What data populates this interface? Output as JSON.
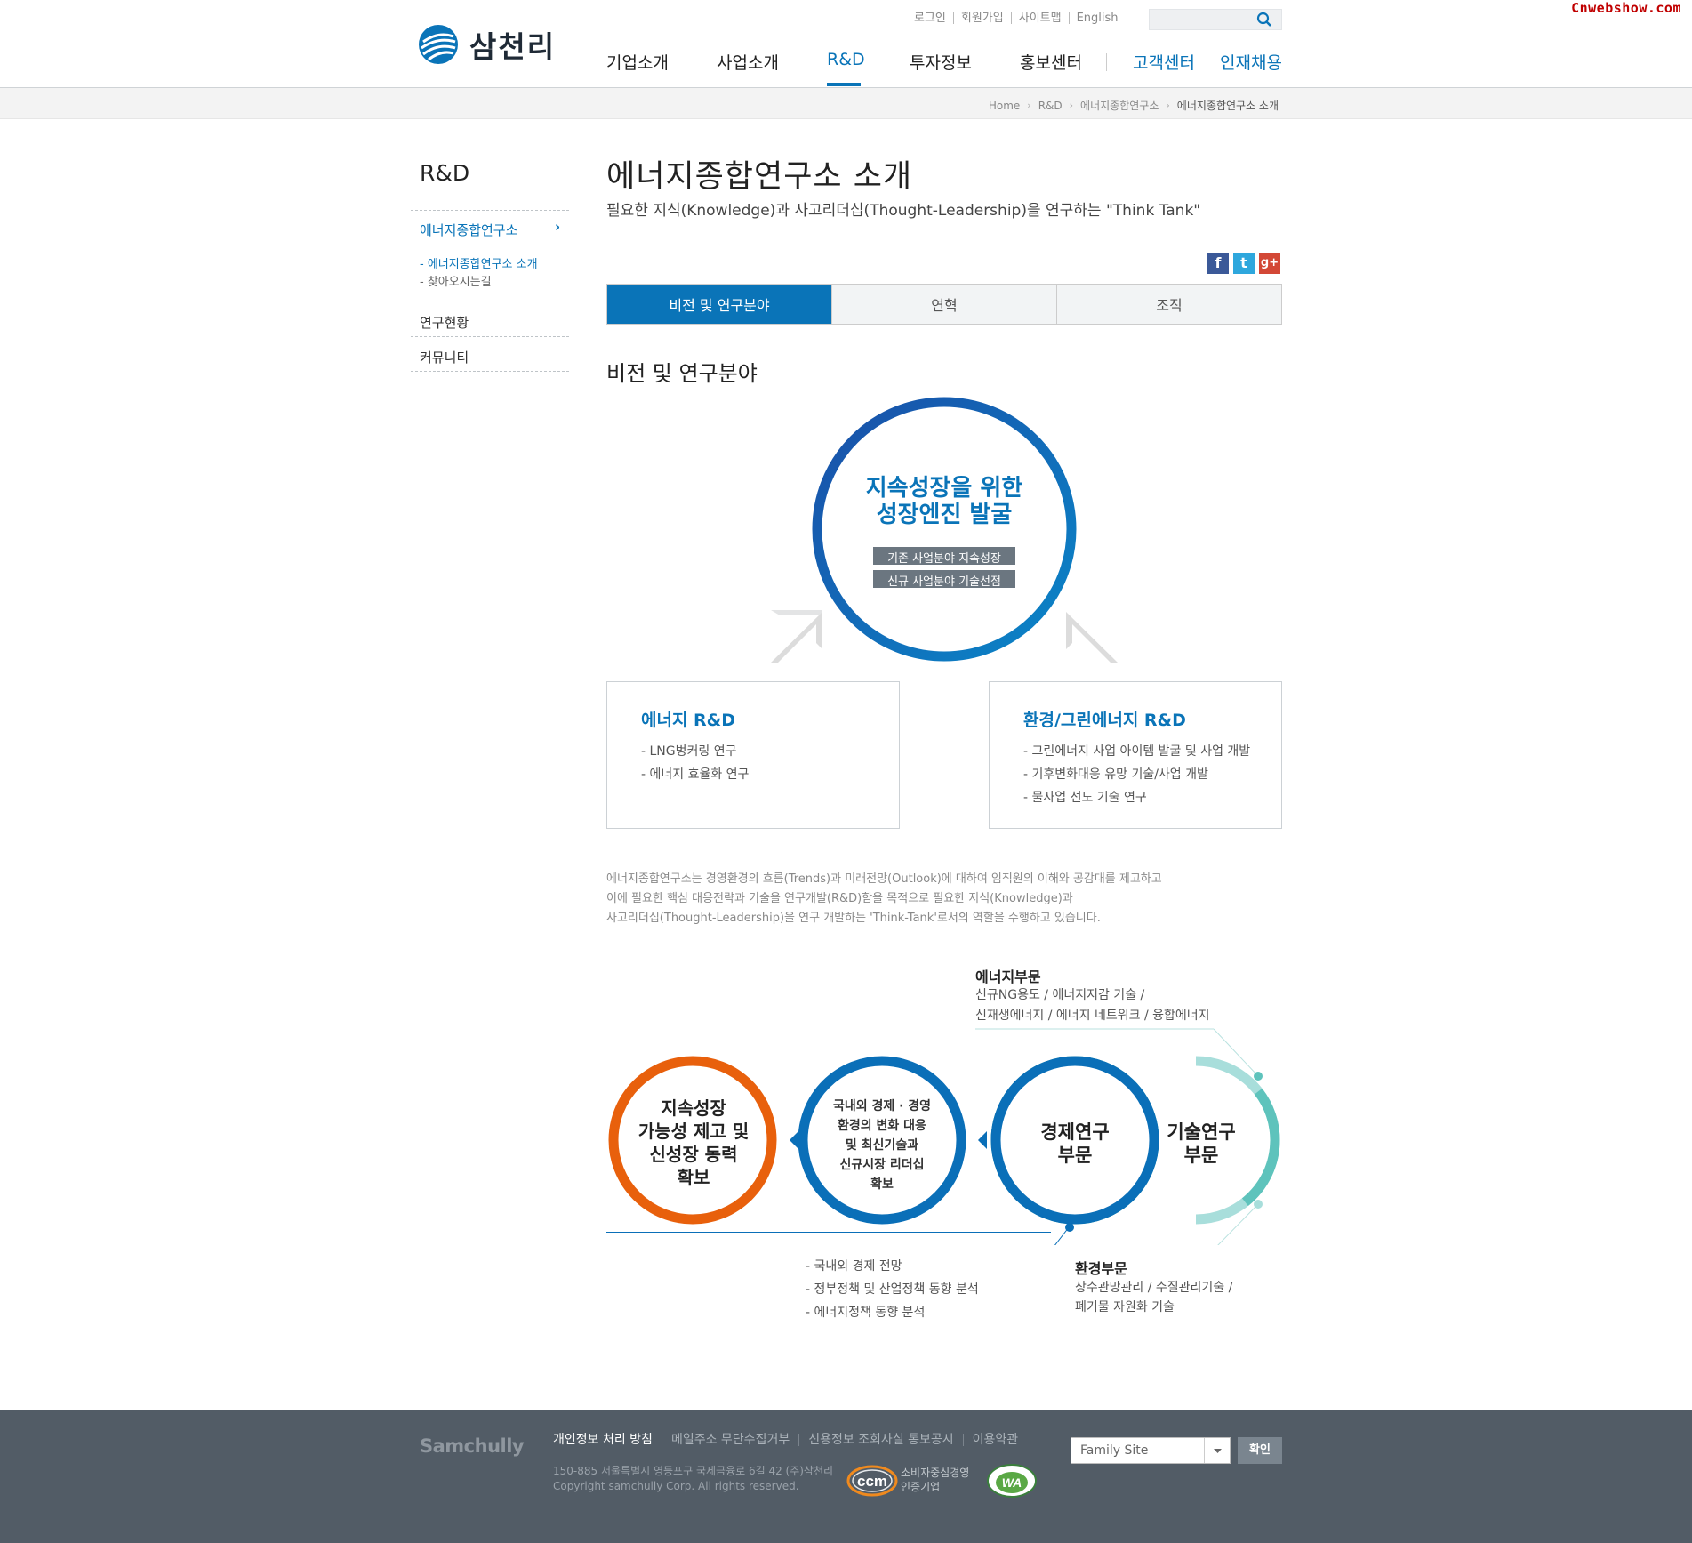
{
  "watermark": "Cnwebshow.com",
  "brand": {
    "name": "삼천리",
    "footer_name": "Samchully"
  },
  "utility": [
    "로그인",
    "회원가입",
    "사이트맵",
    "English"
  ],
  "gnb": [
    "기업소개",
    "사업소개",
    "R&D",
    "투자정보",
    "홍보센터",
    "고객센터",
    "인재채용"
  ],
  "breadcrumb": [
    "Home",
    "R&D",
    "에너지종합연구소",
    "에너지종합연구소 소개"
  ],
  "sidebar": {
    "title": "R&D",
    "current": "에너지종합연구소",
    "subitems": [
      "- 에너지종합연구소 소개",
      "- 찾아오시는길"
    ],
    "items": [
      "연구현황",
      "커뮤니티"
    ]
  },
  "page": {
    "title": "에너지종합연구소 소개",
    "subtitle": "필요한 지식(Knowledge)과 사고리더십(Thought-Leadership)을 연구하는 \"Think Tank\""
  },
  "sns": [
    "f",
    "t",
    "g+"
  ],
  "tabs": [
    "비전 및 연구분야",
    "연혁",
    "조직"
  ],
  "section_title": "비전 및 연구분야",
  "vision": {
    "line1": "지속성장을 위한",
    "line2": "성장엔진 발굴",
    "tag1": "기존 사업분야 지속성장",
    "tag2": "신규 사업분야 기술선점"
  },
  "box_left": {
    "title": "에너지 R&D",
    "items": [
      "- LNG벙커링 연구",
      "- 에너지 효율화 연구"
    ]
  },
  "box_right": {
    "title": "환경/그린에너지 R&D",
    "items": [
      "- 그린에너지 사업 아이템 발굴 및 사업 개발",
      "- 기후변화대응 유망 기술/사업 개발",
      "- 물사업 선도 기술 연구"
    ]
  },
  "description": [
    "에너지종합연구소는 경영환경의 흐름(Trends)과 미래전망(Outlook)에 대하여 임직원의 이해와 공감대를 제고하고",
    "이에 필요한 핵심 대응전략과 기술을 연구개발(R&D)함을 목적으로 필요한 지식(Knowledge)과",
    "사고리더십(Thought-Leadership)을 연구 개발하는 'Think-Tank'로서의 역할을 수행하고 있습니다."
  ],
  "org": {
    "circle1": [
      "지속성장",
      "가능성 제고 및",
      "신성장 동력",
      "확보"
    ],
    "circle2": [
      "국내외 경제 · 경영",
      "환경의 변화 대응",
      "및 최신기술과",
      "신규시장 리더십",
      "확보"
    ],
    "circle3": [
      "경제연구",
      "부문"
    ],
    "circle4": [
      "기술연구",
      "부문"
    ],
    "energy": {
      "title": "에너지부문",
      "lines": [
        "신규NG용도 / 에너지저감 기술 /",
        "신재생에너지 / 에너지 네트워크 / 융합에너지"
      ]
    },
    "economy": [
      "- 국내외 경제 전망",
      "- 정부정책 및 산업정책 동향 분석",
      "- 에너지정책 동향 분석"
    ],
    "env": {
      "title": "환경부문",
      "lines": [
        "상수관망관리 / 수질관리기술 /",
        "폐기물 자원화 기술"
      ]
    }
  },
  "footer": {
    "links": [
      "개인정보 처리 방침",
      "메일주소 무단수집거부",
      "신용정보 조회사실 통보공시",
      "이용약관"
    ],
    "address": "150-885 서울특별시 영등포구 국제금융로 6길 42 (주)삼천리",
    "copyright": "Copyright samchully Corp. All rights reserved.",
    "ccm_logo": "ccm",
    "ccm_text1": "소비자중심경영",
    "ccm_text2": "인증기업",
    "wa_logo": "WA",
    "family_site": "Family Site",
    "confirm": "확인"
  },
  "colors": {
    "primary": "#0a74b8",
    "orange": "#e8600c",
    "teal": "#1fa39b",
    "footer": "#525c66"
  }
}
